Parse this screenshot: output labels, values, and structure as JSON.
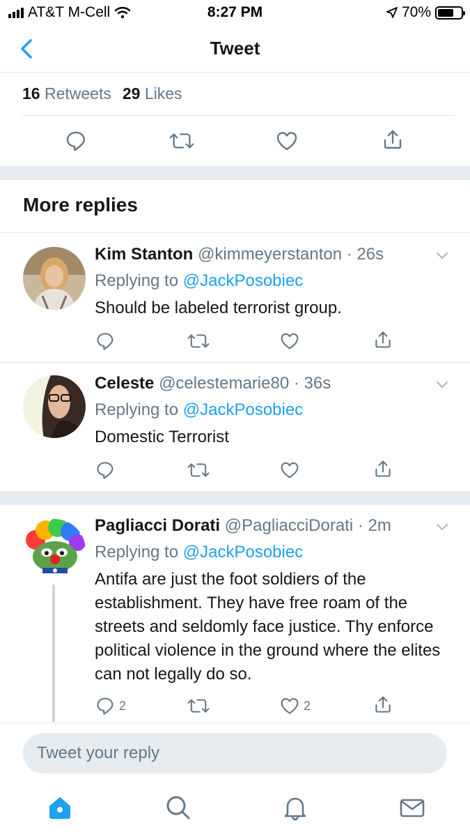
{
  "status_bar": {
    "carrier": "AT&T M-Cell",
    "time": "8:27 PM",
    "battery": "70%"
  },
  "header": {
    "title": "Tweet"
  },
  "stats": {
    "retweets_count": "16",
    "retweets_label": "Retweets",
    "likes_count": "29",
    "likes_label": "Likes"
  },
  "section": {
    "title": "More replies"
  },
  "replies": [
    {
      "name": "Kim Stanton",
      "handle": "@kimmeyerstanton",
      "sep": "·",
      "time": "26s",
      "replying_label": "Replying to",
      "replying_to": "@JackPosobiec",
      "text": "Should be labeled terrorist group.",
      "reply_count": "",
      "like_count": ""
    },
    {
      "name": "Celeste",
      "handle": "@celestemarie80",
      "sep": "·",
      "time": "36s",
      "replying_label": "Replying to",
      "replying_to": "@JackPosobiec",
      "text": "Domestic Terrorist",
      "reply_count": "",
      "like_count": ""
    },
    {
      "name": "Pagliacci Dorati",
      "handle": "@PagliacciDorati",
      "sep": "·",
      "time": "2m",
      "replying_label": "Replying to",
      "replying_to": "@JackPosobiec",
      "text": "Antifa are just the foot soldiers of the establishment. They have free roam of the streets and seldomly face justice. Thy enforce political violence in the ground where the elites can not legally do so.",
      "reply_count": "2",
      "like_count": "2"
    }
  ],
  "composer": {
    "placeholder": "Tweet your reply"
  },
  "colors": {
    "accent": "#1da1f2",
    "muted": "#657786",
    "text": "#14171a",
    "band": "#e6ecf0"
  },
  "icons": [
    "back-chevron-icon",
    "reply-icon",
    "retweet-icon",
    "like-icon",
    "share-icon",
    "caret-down-icon",
    "home-icon",
    "search-icon",
    "notifications-icon",
    "messages-icon"
  ]
}
